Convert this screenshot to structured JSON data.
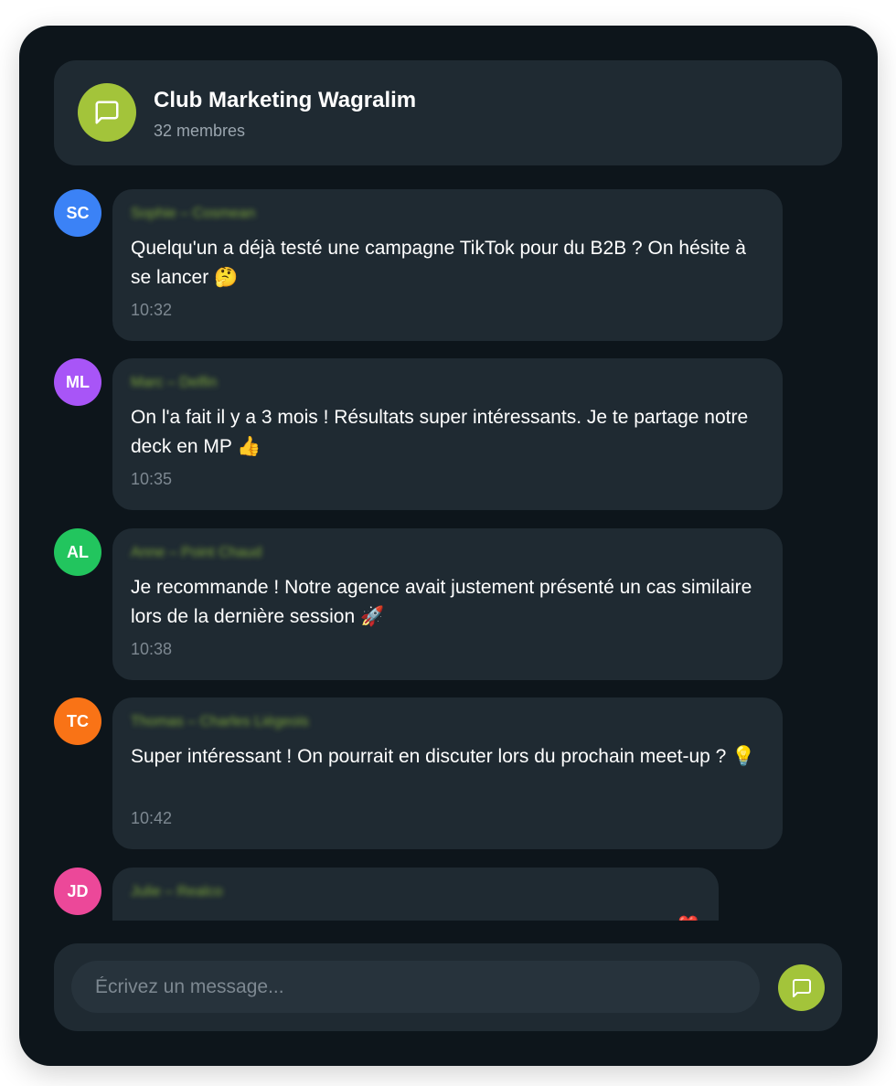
{
  "group": {
    "name": "Club Marketing Wagralim",
    "members": "32 membres",
    "accent_color": "#a3c43a",
    "icon": "message-square-icon"
  },
  "messages": [
    {
      "initials": "SC",
      "avatar_color": "#3b82f6",
      "sender": "Sophie – Cosmean",
      "text": "Quelqu'un a déjà testé une campagne TikTok pour du B2B ? On hésite à se lancer 🤔",
      "time": "10:32"
    },
    {
      "initials": "ML",
      "avatar_color": "#a855f7",
      "sender": "Marc – Delfin",
      "text": "On l'a fait il y a 3 mois ! Résultats super intéressants. Je te partage notre deck en MP 👍",
      "time": "10:35"
    },
    {
      "initials": "AL",
      "avatar_color": "#22c55e",
      "sender": "Anne – Point Chaud",
      "text": "Je recommande ! Notre agence avait justement présenté un cas similaire lors de la dernière session 🚀",
      "time": "10:38"
    },
    {
      "initials": "TC",
      "avatar_color": "#f97316",
      "sender": "Thomas – Charles Liégeois",
      "text": "Super intéressant ! On pourrait en discuter lors du prochain meet-up ? 💡",
      "time": "10:42"
    },
    {
      "initials": "JD",
      "avatar_color": "#ec4899",
      "sender": "Julie – Realco",
      "text": "❤️",
      "time": ""
    }
  ],
  "composer": {
    "placeholder": "Écrivez un message...",
    "send_icon": "message-square-icon"
  }
}
